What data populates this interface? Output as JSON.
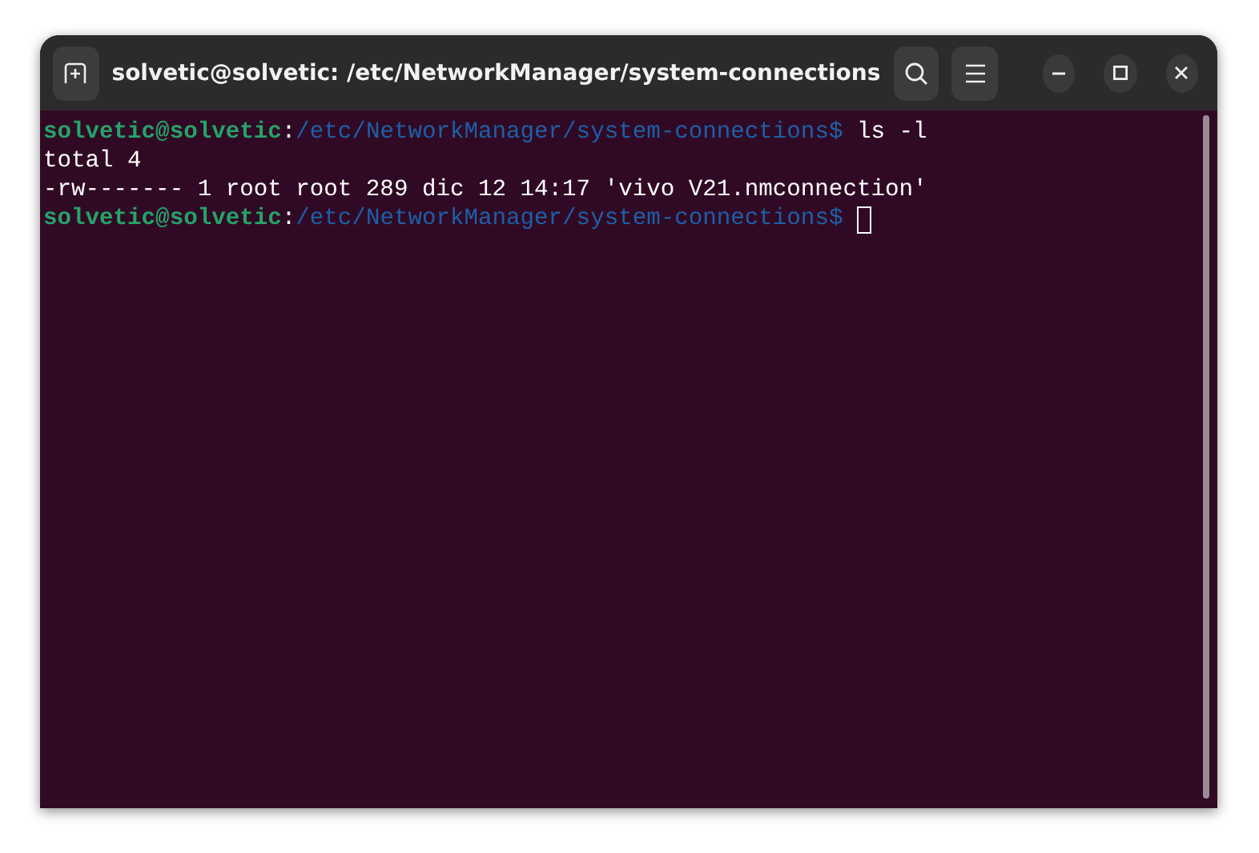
{
  "window": {
    "title": "solvetic@solvetic: /etc/NetworkManager/system-connections"
  },
  "terminal": {
    "lines": [
      {
        "segments": [
          {
            "kind": "user",
            "text": "solvetic@solvetic"
          },
          {
            "kind": "plain",
            "text": ":"
          },
          {
            "kind": "path",
            "text": "/etc/NetworkManager/system-connections$"
          },
          {
            "kind": "plain",
            "text": " ls -l"
          }
        ],
        "cursor": false
      },
      {
        "segments": [
          {
            "kind": "plain",
            "text": "total 4"
          }
        ],
        "cursor": false
      },
      {
        "segments": [
          {
            "kind": "plain",
            "text": "-rw------- 1 root root 289 dic 12 14:17 'vivo V21.nmconnection'"
          }
        ],
        "cursor": false
      },
      {
        "segments": [
          {
            "kind": "user",
            "text": "solvetic@solvetic"
          },
          {
            "kind": "plain",
            "text": ":"
          },
          {
            "kind": "path",
            "text": "/etc/NetworkManager/system-connections$"
          }
        ],
        "cursor": true
      }
    ]
  }
}
